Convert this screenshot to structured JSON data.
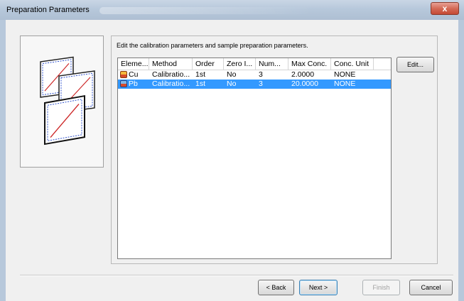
{
  "window": {
    "title": "Preparation Parameters",
    "close_glyph": "x"
  },
  "instructions": "Edit the calibration parameters and sample preparation parameters.",
  "table": {
    "columns": [
      "Eleme...",
      "Method",
      "Order",
      "Zero I...",
      "Num...",
      "Max Conc.",
      "Conc. Unit"
    ],
    "rows": [
      {
        "element": "Cu",
        "method": "Calibratio...",
        "order": "1st",
        "zero": "No",
        "num": "3",
        "max_conc": "2.0000",
        "unit": "NONE",
        "selected": false,
        "icon": "element-cu-icon"
      },
      {
        "element": "Pb",
        "method": "Calibratio...",
        "order": "1st",
        "zero": "No",
        "num": "3",
        "max_conc": "20.0000",
        "unit": "NONE",
        "selected": true,
        "icon": "element-pb-icon"
      }
    ]
  },
  "buttons": {
    "edit": "Edit...",
    "back": "< Back",
    "next": "Next >",
    "finish": "Finish",
    "cancel": "Cancel"
  },
  "colors": {
    "selection": "#3399ff",
    "titlebar": "#b7c8db",
    "close_button": "#c44a35"
  }
}
